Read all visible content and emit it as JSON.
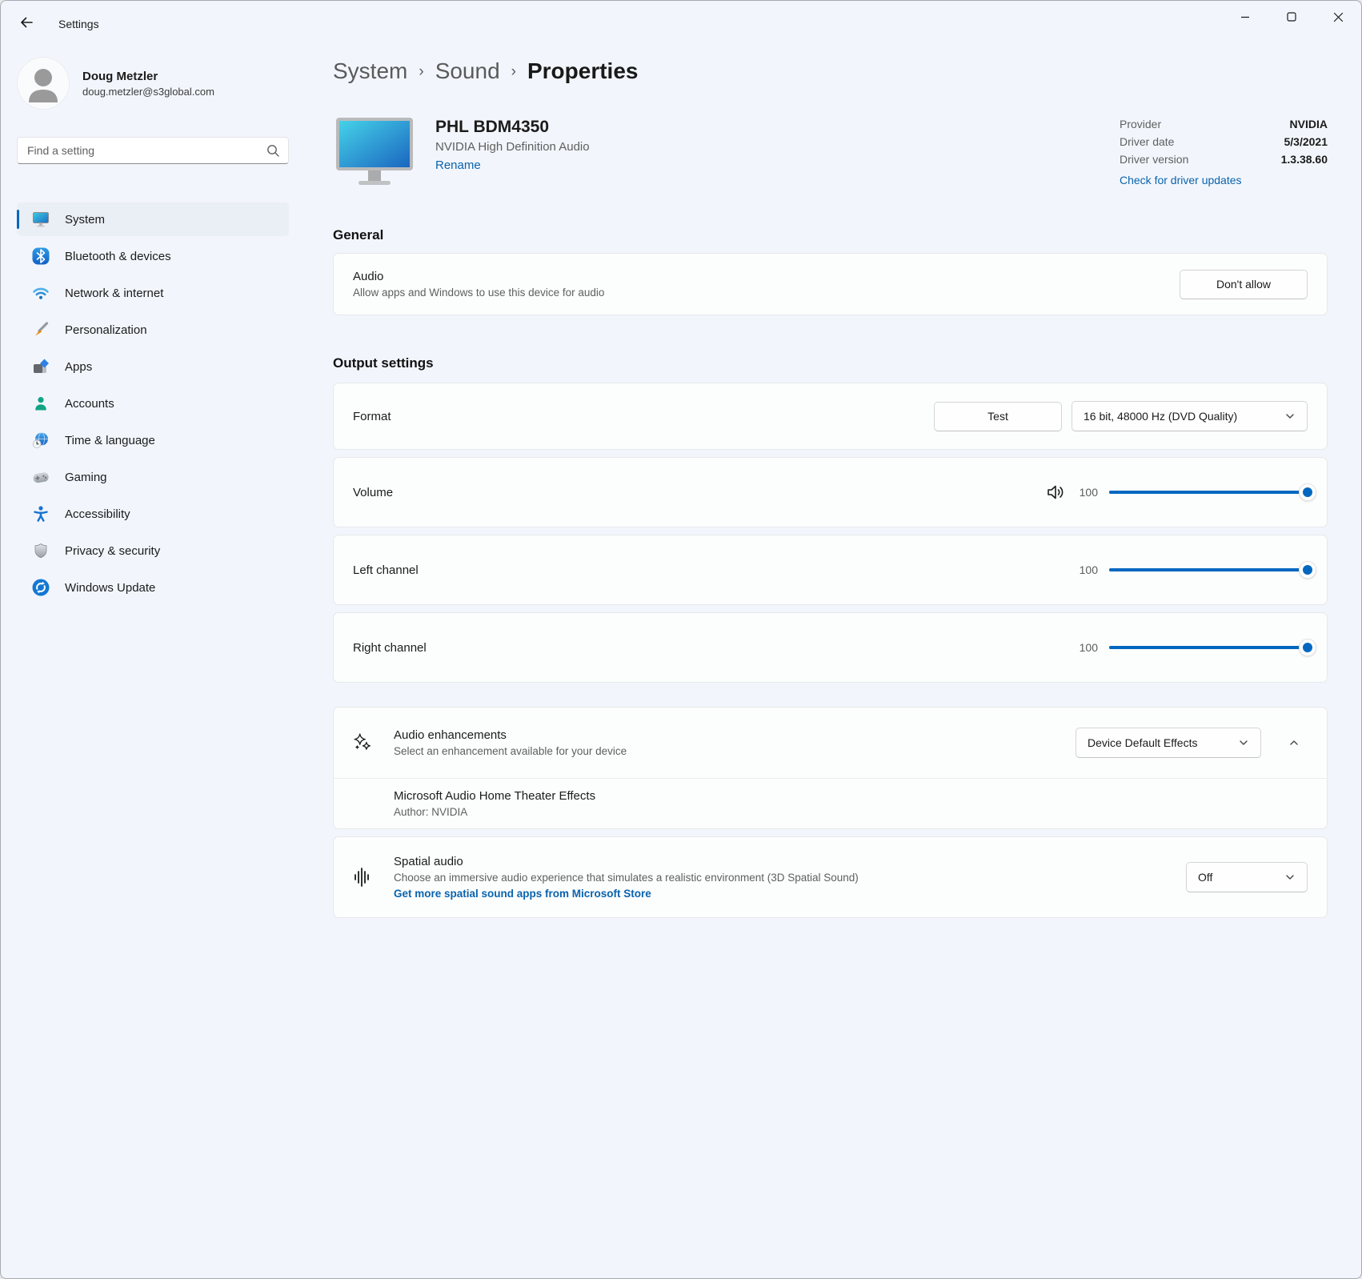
{
  "window": {
    "title": "Settings"
  },
  "profile": {
    "name": "Doug Metzler",
    "email": "doug.metzler@s3global.com"
  },
  "search": {
    "placeholder": "Find a setting"
  },
  "sidebar": {
    "items": [
      {
        "label": "System",
        "icon": "monitor-icon",
        "selected": true
      },
      {
        "label": "Bluetooth & devices",
        "icon": "bluetooth-icon",
        "selected": false
      },
      {
        "label": "Network & internet",
        "icon": "wifi-icon",
        "selected": false
      },
      {
        "label": "Personalization",
        "icon": "paintbrush-icon",
        "selected": false
      },
      {
        "label": "Apps",
        "icon": "apps-icon",
        "selected": false
      },
      {
        "label": "Accounts",
        "icon": "person-icon",
        "selected": false
      },
      {
        "label": "Time & language",
        "icon": "clock-globe-icon",
        "selected": false
      },
      {
        "label": "Gaming",
        "icon": "gamepad-icon",
        "selected": false
      },
      {
        "label": "Accessibility",
        "icon": "accessibility-icon",
        "selected": false
      },
      {
        "label": "Privacy & security",
        "icon": "shield-icon",
        "selected": false
      },
      {
        "label": "Windows Update",
        "icon": "update-icon",
        "selected": false
      }
    ]
  },
  "breadcrumb": {
    "items": [
      "System",
      "Sound",
      "Properties"
    ],
    "separator": "›"
  },
  "device": {
    "name": "PHL BDM4350",
    "subtitle": "NVIDIA High Definition Audio",
    "rename_label": "Rename"
  },
  "driver": {
    "rows": [
      {
        "label": "Provider",
        "value": "NVIDIA"
      },
      {
        "label": "Driver date",
        "value": "5/3/2021"
      },
      {
        "label": "Driver version",
        "value": "1.3.38.60"
      }
    ],
    "update_link": "Check for driver updates"
  },
  "general": {
    "heading": "General",
    "audio": {
      "title": "Audio",
      "description": "Allow apps and Windows to use this device for audio",
      "button_label": "Don't allow"
    }
  },
  "output": {
    "heading": "Output settings",
    "format": {
      "label": "Format",
      "test_button": "Test",
      "selected": "16 bit, 48000 Hz (DVD Quality)"
    },
    "sliders": [
      {
        "label": "Volume",
        "value": "100"
      },
      {
        "label": "Left channel",
        "value": "100"
      },
      {
        "label": "Right channel",
        "value": "100"
      }
    ]
  },
  "enhancements": {
    "title": "Audio enhancements",
    "description": "Select an enhancement available for your device",
    "selected": "Device Default Effects",
    "expanded_item": {
      "title": "Microsoft Audio Home Theater Effects",
      "author": "Author: NVIDIA"
    }
  },
  "spatial": {
    "title": "Spatial audio",
    "description": "Choose an immersive audio experience that simulates a realistic environment (3D Spatial Sound)",
    "link": "Get more spatial sound apps from Microsoft Store",
    "selected": "Off"
  },
  "icons": {
    "back": "arrow-left",
    "search": "magnifier",
    "window": [
      "minimize",
      "maximize",
      "close"
    ],
    "volume": "speaker-waves",
    "enhancements": "sparkles",
    "spatial": "waveform-bars",
    "dropdown": "chevron-down",
    "expander": "chevron-up"
  },
  "colors": {
    "accent": "#0067c0",
    "link": "#0a63ad",
    "background": "#f2f6fc",
    "card": "#fcfdfd"
  }
}
